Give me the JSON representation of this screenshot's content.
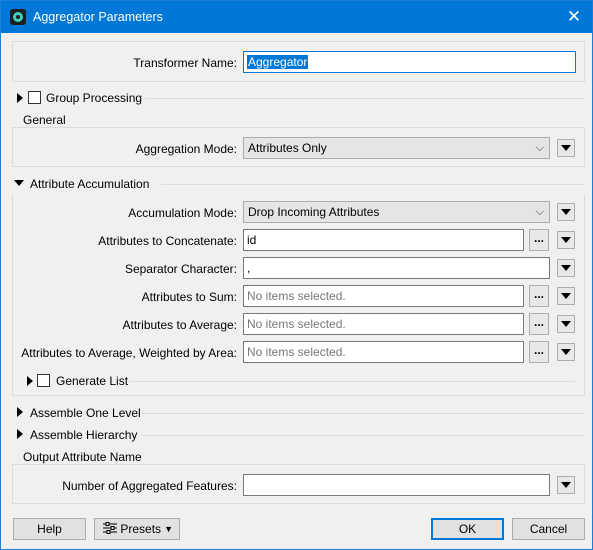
{
  "window": {
    "title": "Aggregator Parameters",
    "close_glyph": "✕"
  },
  "transformer": {
    "name_label": "Transformer Name:",
    "name_value": "Aggregator"
  },
  "group_processing": {
    "label": "Group Processing",
    "checked": false
  },
  "general": {
    "title": "General",
    "aggregation_mode_label": "Aggregation Mode:",
    "aggregation_mode_value": "Attributes Only"
  },
  "attribute_accumulation": {
    "title": "Attribute Accumulation",
    "accumulation_mode_label": "Accumulation Mode:",
    "accumulation_mode_value": "Drop Incoming Attributes",
    "concat_label": "Attributes to Concatenate:",
    "concat_value": "id",
    "separator_label": "Separator Character:",
    "separator_value": ",",
    "sum_label": "Attributes to Sum:",
    "sum_placeholder": "No items selected.",
    "avg_label": "Attributes to Average:",
    "avg_placeholder": "No items selected.",
    "avg_weighted_label": "Attributes to Average, Weighted by Area:",
    "avg_weighted_placeholder": "No items selected.",
    "generate_list_label": "Generate List",
    "dots": "..."
  },
  "assemble_one_level": {
    "label": "Assemble One Level"
  },
  "assemble_hierarchy": {
    "label": "Assemble Hierarchy"
  },
  "output": {
    "title": "Output Attribute Name",
    "count_label": "Number of Aggregated Features:",
    "count_value": ""
  },
  "footer": {
    "help": "Help",
    "presets": "Presets",
    "ok": "OK",
    "cancel": "Cancel"
  },
  "colors": {
    "titlebar": "#0078d7",
    "selection": "#0078d7",
    "dialog_bg": "#f0f0f0"
  },
  "icons": [
    "app-icon",
    "close-icon",
    "chevron-down-icon",
    "menu-arrow-icon",
    "expand-arrow-icon",
    "collapse-arrow-icon",
    "sliders-icon"
  ]
}
